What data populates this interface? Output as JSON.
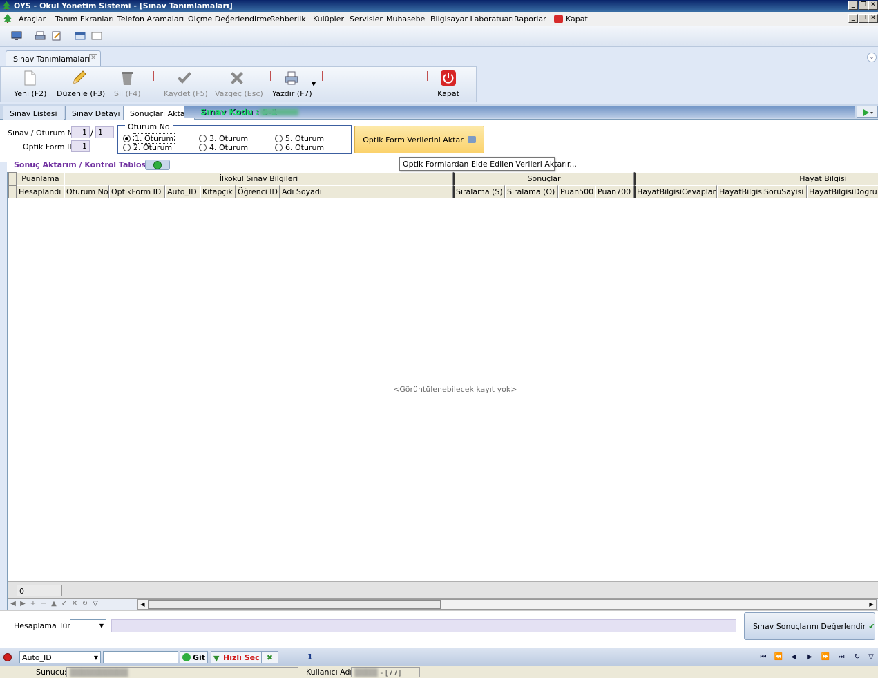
{
  "window": {
    "title": "OYS - Okul Yönetim Sistemi - [Sınav Tanımlamaları]"
  },
  "menu": [
    "Araçlar",
    "Tanım Ekranları",
    "Telefon Aramaları",
    "Ölçme Değerlendirme",
    "Rehberlik",
    "Kulüpler",
    "Servisler",
    "Muhasebe",
    "Bilgisayar Laboratuarı",
    "Raporlar",
    "Kapat"
  ],
  "doc_tab": {
    "label": "Sınav Tanımlamaları"
  },
  "toolbar": {
    "new": "Yeni (F2)",
    "edit": "Düzenle (F3)",
    "delete": "Sil (F4)",
    "save": "Kaydet (F5)",
    "cancel": "Vazgeç (Esc)",
    "print": "Yazdır (F7)",
    "close": "Kapat"
  },
  "sub_tabs": [
    "Sınav Listesi",
    "Sınav Detayı",
    "Sonuçları Aktar"
  ],
  "sinav_kodu": {
    "label": "Sınav Kodu :",
    "value": "3-1"
  },
  "form": {
    "oturum_label": "Sınav / Oturum No",
    "oturum_value1": "1",
    "oturum_sep": "/",
    "oturum_value2": "1",
    "optik_label": "Optik Form ID",
    "optik_value": "1",
    "group_label": "Oturum No",
    "radios": [
      "1. Oturum",
      "2. Oturum",
      "3. Oturum",
      "4. Oturum",
      "5. Oturum",
      "6. Oturum"
    ],
    "selected_radio": "1. Oturum",
    "aktar_button": "Optik Form Verilerini Aktar",
    "tooltip": "Optik Formlardan Elde Edilen Verileri Aktarır..."
  },
  "grid": {
    "title": "Sonuç Aktarım / Kontrol Tablosu",
    "bands": [
      "Puanlama",
      "İlkokul Sınav Bilgileri",
      "Sonuçlar",
      "Hayat Bilgisi"
    ],
    "columns": [
      "Hesaplandı",
      "Oturum No",
      "OptikForm ID",
      "Auto_ID",
      "Kitapçık",
      "Öğrenci ID",
      "Adı Soyadı",
      "Sıralama (S)",
      "Sıralama (O)",
      "Puan500",
      "Puan700",
      "HayatBilgisiCevaplar",
      "HayatBilgisiSoruSayisi",
      "HayatBilgisiDogru"
    ],
    "empty_text": "<Görüntülenebilecek kayıt yok>",
    "footer_count": "0"
  },
  "hesaplama": {
    "label": "Hesaplama Türü",
    "select_value": "",
    "evaluate_button": "Sınav Sonuçlarını Değerlendir"
  },
  "bottom": {
    "field_select": "Auto_ID",
    "search_value": "",
    "go_button": "Git",
    "quick_select": "Hızlı Seç",
    "page": "1"
  },
  "status": {
    "server_label": "Sunucu:",
    "user_label": "Kullanıcı Adı:",
    "user_suffix": "- [77]"
  },
  "colors": {
    "accent_title": "#7030a0",
    "titlebar": "#0a246a",
    "highlight_button": "#fbd26c"
  }
}
